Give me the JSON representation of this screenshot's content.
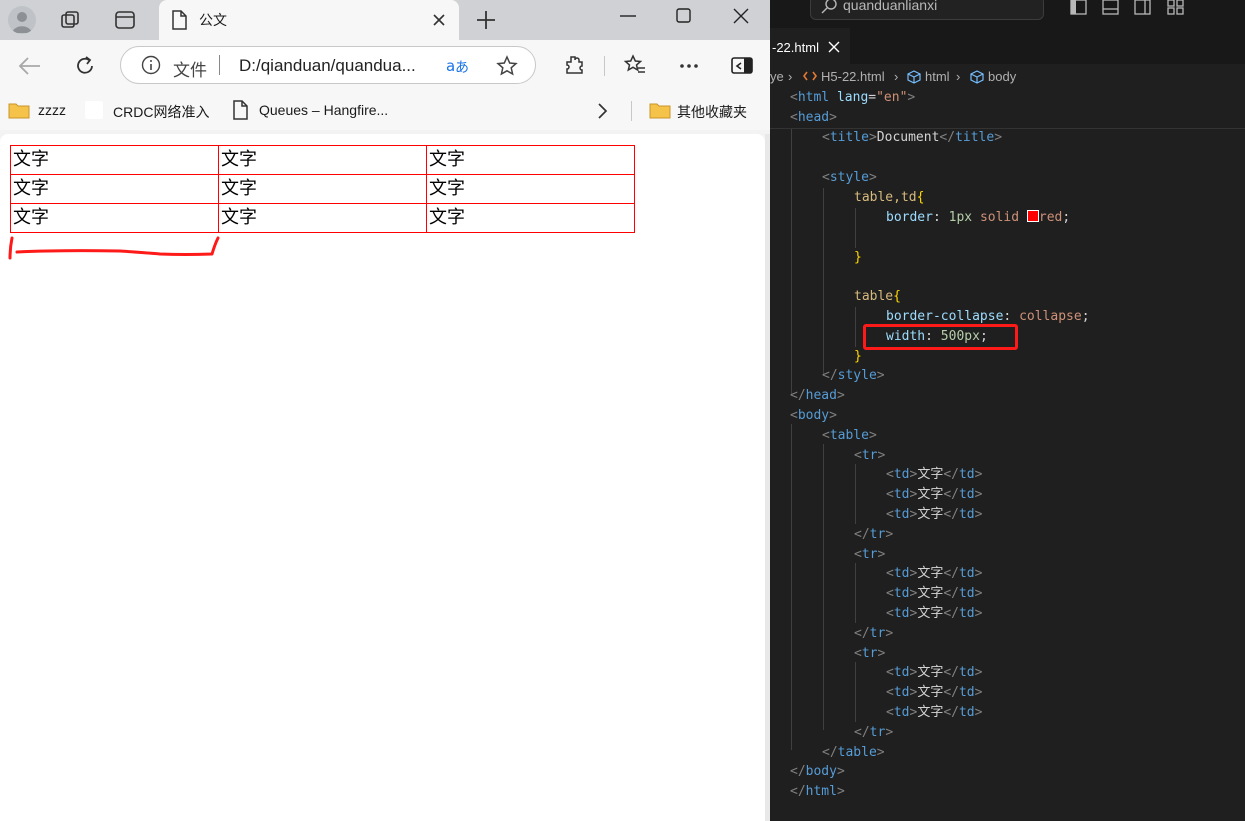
{
  "browser": {
    "tab_title": "公文",
    "address": {
      "prefix": "文件",
      "url": "D:/qianduan/quandua..."
    },
    "bookmarks": [
      {
        "label": "zzzz",
        "icon": "folder-icon"
      },
      {
        "label": "CRDC网络准入",
        "icon": "blank-page-icon"
      },
      {
        "label": "Queues – Hangfire...",
        "icon": "page-icon"
      }
    ],
    "other_bookmarks": "其他收藏夹",
    "table_rows": [
      [
        "文字",
        "文字",
        "文字"
      ],
      [
        "文字",
        "文字",
        "文字"
      ],
      [
        "文字",
        "文字",
        "文字"
      ]
    ]
  },
  "editor": {
    "search_text": "quanduanlianxi",
    "tab_label": "-22.html",
    "breadcrumb": [
      "ye",
      "H5-22.html",
      "html",
      "body"
    ],
    "code": {
      "l1_tag": "html",
      "l1_attr": "lang",
      "l1_val": "\"en\"",
      "l2_tag": "head",
      "l3_tag": "title",
      "l3_text": "Document",
      "l5_tag": "style",
      "l6_sel": "table,td",
      "l7_prop": "border",
      "l7_num": "1px",
      "l7_val1": "solid",
      "l7_val2": "red",
      "l10_sel": "table",
      "l11_prop": "border-collapse",
      "l11_val": "collapse",
      "l12_prop": "width",
      "l12_num": "500px",
      "l15_tag": "head",
      "l16_tag": "body",
      "l17_tag": "table",
      "tr_tag": "tr",
      "td_tag": "td",
      "td_text": "文字",
      "l33_tag": "table",
      "l34_tag": "body",
      "l35_tag": "html"
    },
    "swatch_color": "#ff0000"
  },
  "colors": {
    "annotation_red": "#ff0000",
    "table_border": "#ff0000"
  }
}
